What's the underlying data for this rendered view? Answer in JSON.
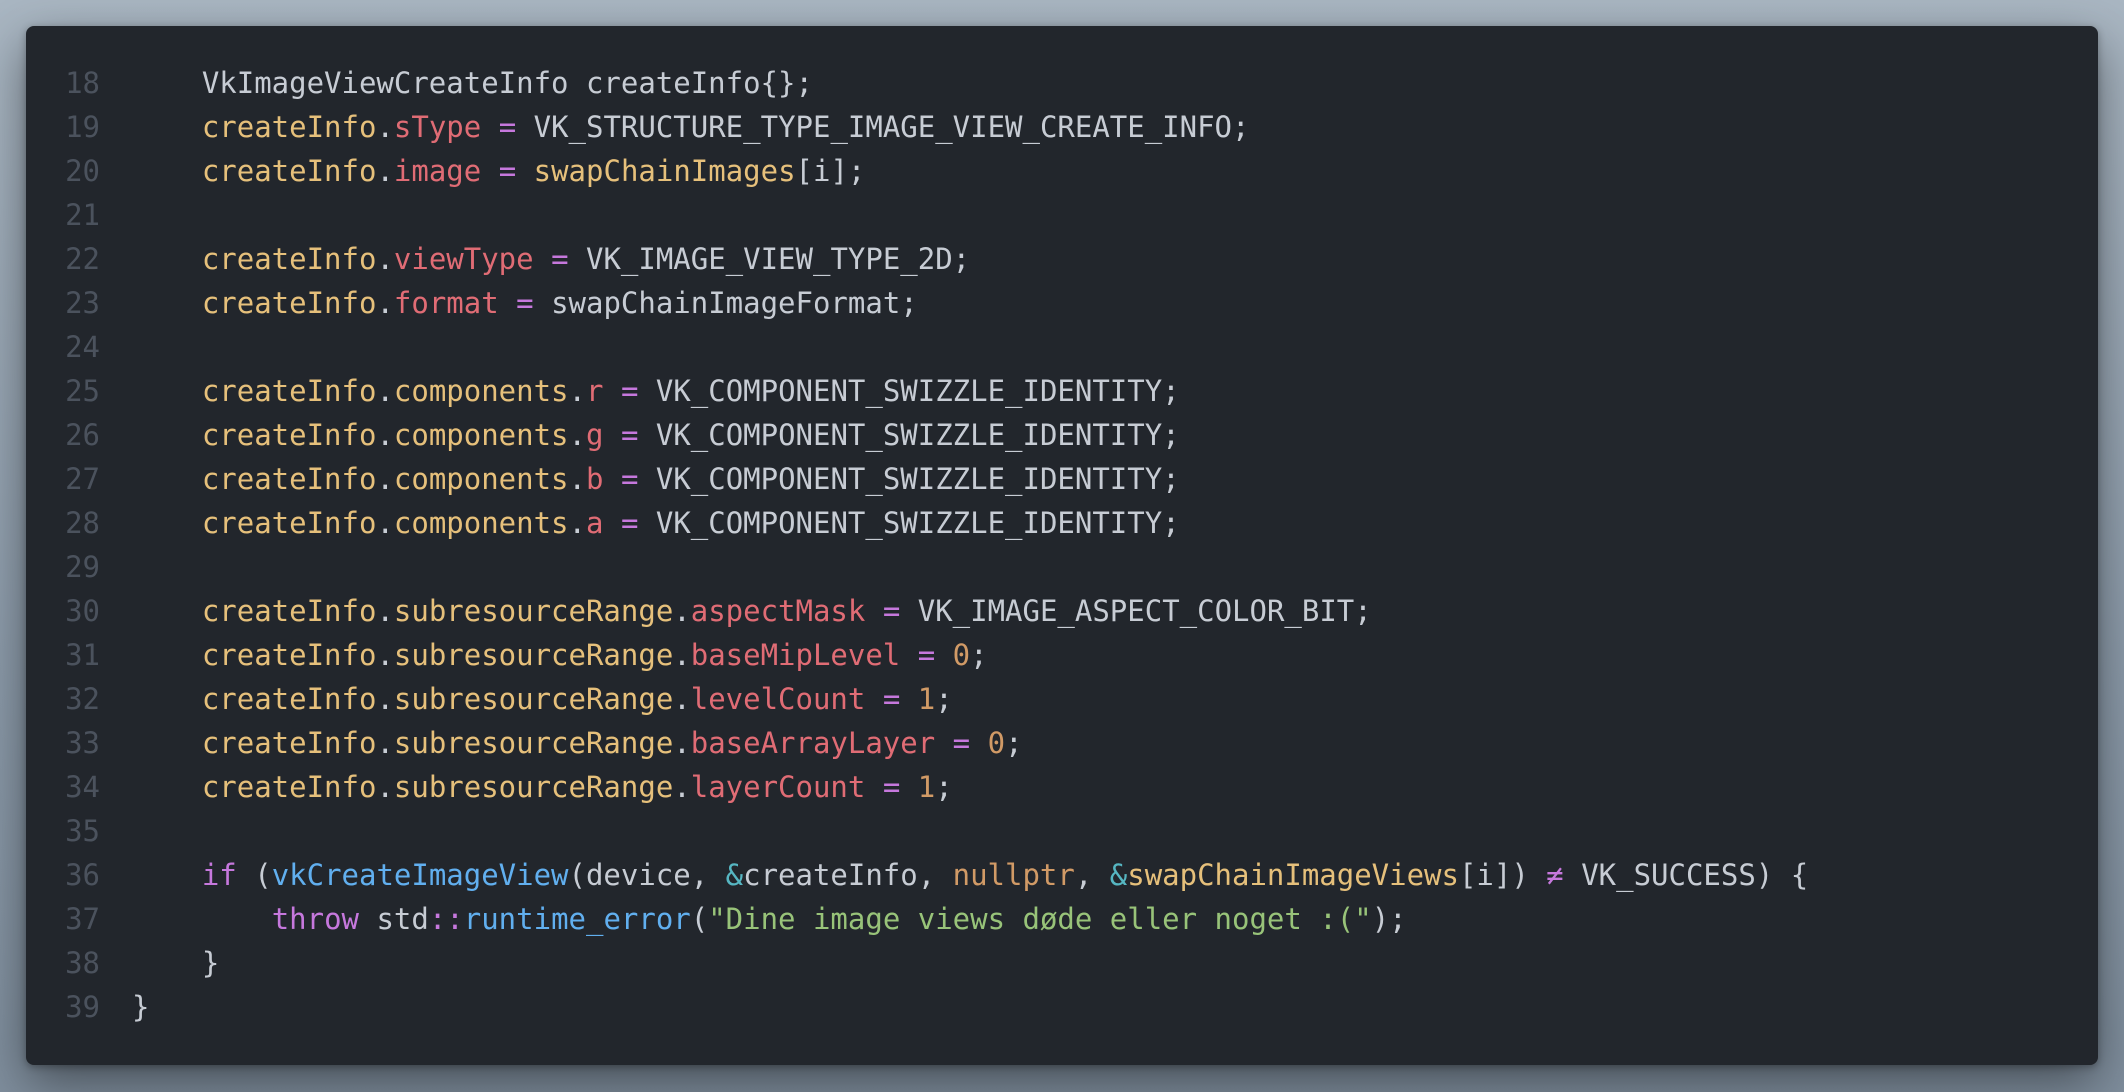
{
  "editor": {
    "lines": [
      {
        "n": "18",
        "tokens": [
          [
            "plain",
            "    VkImageViewCreateInfo createInfo{};"
          ]
        ]
      },
      {
        "n": "19",
        "tokens": [
          [
            "plain",
            "    "
          ],
          [
            "obj",
            "createInfo"
          ],
          [
            "plain",
            "."
          ],
          [
            "prop",
            "sType"
          ],
          [
            "plain",
            " "
          ],
          [
            "op",
            "="
          ],
          [
            "plain",
            " VK_STRUCTURE_TYPE_IMAGE_VIEW_CREATE_INFO;"
          ]
        ]
      },
      {
        "n": "20",
        "tokens": [
          [
            "plain",
            "    "
          ],
          [
            "obj",
            "createInfo"
          ],
          [
            "plain",
            "."
          ],
          [
            "prop",
            "image"
          ],
          [
            "plain",
            " "
          ],
          [
            "op",
            "="
          ],
          [
            "plain",
            " "
          ],
          [
            "obj",
            "swapChainImages"
          ],
          [
            "plain",
            "[i];"
          ]
        ]
      },
      {
        "n": "21",
        "tokens": []
      },
      {
        "n": "22",
        "tokens": [
          [
            "plain",
            "    "
          ],
          [
            "obj",
            "createInfo"
          ],
          [
            "plain",
            "."
          ],
          [
            "prop",
            "viewType"
          ],
          [
            "plain",
            " "
          ],
          [
            "op",
            "="
          ],
          [
            "plain",
            " VK_IMAGE_VIEW_TYPE_2D;"
          ]
        ]
      },
      {
        "n": "23",
        "tokens": [
          [
            "plain",
            "    "
          ],
          [
            "obj",
            "createInfo"
          ],
          [
            "plain",
            "."
          ],
          [
            "prop",
            "format"
          ],
          [
            "plain",
            " "
          ],
          [
            "op",
            "="
          ],
          [
            "plain",
            " swapChainImageFormat;"
          ]
        ]
      },
      {
        "n": "24",
        "tokens": []
      },
      {
        "n": "25",
        "tokens": [
          [
            "plain",
            "    "
          ],
          [
            "obj",
            "createInfo"
          ],
          [
            "plain",
            "."
          ],
          [
            "obj",
            "components"
          ],
          [
            "plain",
            "."
          ],
          [
            "prop",
            "r"
          ],
          [
            "plain",
            " "
          ],
          [
            "op",
            "="
          ],
          [
            "plain",
            " VK_COMPONENT_SWIZZLE_IDENTITY;"
          ]
        ]
      },
      {
        "n": "26",
        "tokens": [
          [
            "plain",
            "    "
          ],
          [
            "obj",
            "createInfo"
          ],
          [
            "plain",
            "."
          ],
          [
            "obj",
            "components"
          ],
          [
            "plain",
            "."
          ],
          [
            "prop",
            "g"
          ],
          [
            "plain",
            " "
          ],
          [
            "op",
            "="
          ],
          [
            "plain",
            " VK_COMPONENT_SWIZZLE_IDENTITY;"
          ]
        ]
      },
      {
        "n": "27",
        "tokens": [
          [
            "plain",
            "    "
          ],
          [
            "obj",
            "createInfo"
          ],
          [
            "plain",
            "."
          ],
          [
            "obj",
            "components"
          ],
          [
            "plain",
            "."
          ],
          [
            "prop",
            "b"
          ],
          [
            "plain",
            " "
          ],
          [
            "op",
            "="
          ],
          [
            "plain",
            " VK_COMPONENT_SWIZZLE_IDENTITY;"
          ]
        ]
      },
      {
        "n": "28",
        "tokens": [
          [
            "plain",
            "    "
          ],
          [
            "obj",
            "createInfo"
          ],
          [
            "plain",
            "."
          ],
          [
            "obj",
            "components"
          ],
          [
            "plain",
            "."
          ],
          [
            "prop",
            "a"
          ],
          [
            "plain",
            " "
          ],
          [
            "op",
            "="
          ],
          [
            "plain",
            " VK_COMPONENT_SWIZZLE_IDENTITY;"
          ]
        ]
      },
      {
        "n": "29",
        "tokens": []
      },
      {
        "n": "30",
        "tokens": [
          [
            "plain",
            "    "
          ],
          [
            "obj",
            "createInfo"
          ],
          [
            "plain",
            "."
          ],
          [
            "obj",
            "subresourceRange"
          ],
          [
            "plain",
            "."
          ],
          [
            "prop",
            "aspectMask"
          ],
          [
            "plain",
            " "
          ],
          [
            "op",
            "="
          ],
          [
            "plain",
            " VK_IMAGE_ASPECT_COLOR_BIT;"
          ]
        ]
      },
      {
        "n": "31",
        "tokens": [
          [
            "plain",
            "    "
          ],
          [
            "obj",
            "createInfo"
          ],
          [
            "plain",
            "."
          ],
          [
            "obj",
            "subresourceRange"
          ],
          [
            "plain",
            "."
          ],
          [
            "prop",
            "baseMipLevel"
          ],
          [
            "plain",
            " "
          ],
          [
            "op",
            "="
          ],
          [
            "plain",
            " "
          ],
          [
            "num",
            "0"
          ],
          [
            "plain",
            ";"
          ]
        ]
      },
      {
        "n": "32",
        "tokens": [
          [
            "plain",
            "    "
          ],
          [
            "obj",
            "createInfo"
          ],
          [
            "plain",
            "."
          ],
          [
            "obj",
            "subresourceRange"
          ],
          [
            "plain",
            "."
          ],
          [
            "prop",
            "levelCount"
          ],
          [
            "plain",
            " "
          ],
          [
            "op",
            "="
          ],
          [
            "plain",
            " "
          ],
          [
            "num",
            "1"
          ],
          [
            "plain",
            ";"
          ]
        ]
      },
      {
        "n": "33",
        "tokens": [
          [
            "plain",
            "    "
          ],
          [
            "obj",
            "createInfo"
          ],
          [
            "plain",
            "."
          ],
          [
            "obj",
            "subresourceRange"
          ],
          [
            "plain",
            "."
          ],
          [
            "prop",
            "baseArrayLayer"
          ],
          [
            "plain",
            " "
          ],
          [
            "op",
            "="
          ],
          [
            "plain",
            " "
          ],
          [
            "num",
            "0"
          ],
          [
            "plain",
            ";"
          ]
        ]
      },
      {
        "n": "34",
        "tokens": [
          [
            "plain",
            "    "
          ],
          [
            "obj",
            "createInfo"
          ],
          [
            "plain",
            "."
          ],
          [
            "obj",
            "subresourceRange"
          ],
          [
            "plain",
            "."
          ],
          [
            "prop",
            "layerCount"
          ],
          [
            "plain",
            " "
          ],
          [
            "op",
            "="
          ],
          [
            "plain",
            " "
          ],
          [
            "num",
            "1"
          ],
          [
            "plain",
            ";"
          ]
        ]
      },
      {
        "n": "35",
        "tokens": []
      },
      {
        "n": "36",
        "tokens": [
          [
            "plain",
            "    "
          ],
          [
            "kw",
            "if"
          ],
          [
            "plain",
            " ("
          ],
          [
            "fn",
            "vkCreateImageView"
          ],
          [
            "plain",
            "(device, "
          ],
          [
            "amp",
            "&"
          ],
          [
            "plain",
            "createInfo, "
          ],
          [
            "nullp",
            "nullptr"
          ],
          [
            "plain",
            ", "
          ],
          [
            "amp",
            "&"
          ],
          [
            "obj",
            "swapChainImageViews"
          ],
          [
            "plain",
            "[i]) "
          ],
          [
            "op",
            "≠"
          ],
          [
            "plain",
            " VK_SUCCESS) {"
          ]
        ]
      },
      {
        "n": "37",
        "tokens": [
          [
            "plain",
            "        "
          ],
          [
            "kw",
            "throw"
          ],
          [
            "plain",
            " std"
          ],
          [
            "op",
            "::"
          ],
          [
            "fn",
            "runtime_error"
          ],
          [
            "plain",
            "("
          ],
          [
            "str",
            "\"Dine image views døde eller noget :(\""
          ],
          [
            "plain",
            ");"
          ]
        ]
      },
      {
        "n": "38",
        "tokens": [
          [
            "plain",
            "    }"
          ]
        ]
      },
      {
        "n": "39",
        "tokens": [
          [
            "plain",
            "}"
          ]
        ]
      }
    ]
  }
}
